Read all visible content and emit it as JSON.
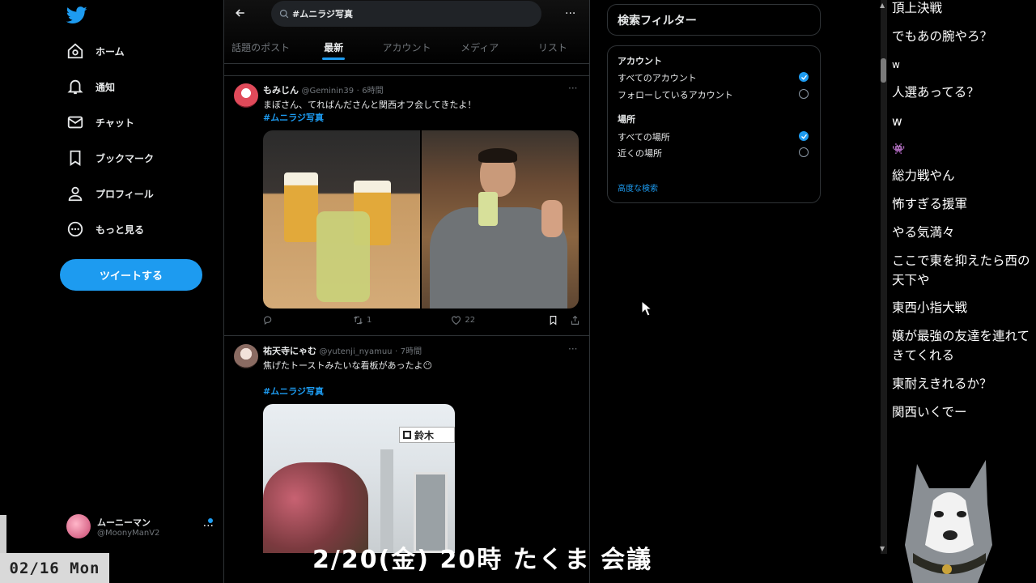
{
  "sidebar": {
    "nav": [
      {
        "label": "ホーム",
        "icon": "home-icon"
      },
      {
        "label": "通知",
        "icon": "bell-icon"
      },
      {
        "label": "チャット",
        "icon": "mail-icon"
      },
      {
        "label": "ブックマーク",
        "icon": "bookmark-icon"
      },
      {
        "label": "プロフィール",
        "icon": "person-icon"
      },
      {
        "label": "もっと見る",
        "icon": "more-circle-icon"
      }
    ],
    "tweet_button": "ツイートする",
    "account": {
      "name": "ムーニーマン",
      "handle": "@MoonyManV2",
      "more": "···"
    }
  },
  "search": {
    "query": "#ムニラジ写真",
    "more": "···"
  },
  "tabs": [
    {
      "label": "話題のポスト",
      "active": false
    },
    {
      "label": "最新",
      "active": true
    },
    {
      "label": "アカウント",
      "active": false
    },
    {
      "label": "メディア",
      "active": false
    },
    {
      "label": "リスト",
      "active": false
    }
  ],
  "tweets": [
    {
      "name": "もみじん",
      "handle": "@Geminin39",
      "time": "6時間",
      "text": "まぼさん、てればんださんと関西オフ会してきたよ！",
      "hashtag": "#ムニラジ写真",
      "retweets": "1",
      "likes": "22",
      "more": "···"
    },
    {
      "name": "祐天寺にゃむ",
      "handle": "@yutenji_nyamuu",
      "time": "7時間",
      "text": "焦げたトーストみたいな看板があったよ😶",
      "hashtag": "#ムニラジ写真",
      "sign_text": "鈴木",
      "more": "···"
    }
  ],
  "filters": {
    "title": "検索フィルター",
    "account_section": "アカウント",
    "account_options": [
      {
        "label": "すべてのアカウント",
        "selected": true
      },
      {
        "label": "フォローしているアカウント",
        "selected": false
      }
    ],
    "place_section": "場所",
    "place_options": [
      {
        "label": "すべての場所",
        "selected": true
      },
      {
        "label": "近くの場所",
        "selected": false
      }
    ],
    "advanced": "高度な検索"
  },
  "chat": [
    "頂上決戦",
    "でもあの腕やろ？",
    "w",
    "人選あってる？",
    "w",
    "👾",
    "総力戦やん",
    "怖すぎる援軍",
    "やる気満々",
    "ここで東を抑えたら西の天下や",
    "東西小指大戦",
    "嬢が最強の友達を連れてきてくれる",
    "東耐えきれるか？",
    "関西いくでー"
  ],
  "overlay": {
    "date": "02/16 Mon",
    "subtitle": "2/20(金) 20時 たくま 会議"
  },
  "colors": {
    "accent": "#1d9bf0",
    "background": "#000000",
    "border": "#2f3336",
    "muted": "#71767b"
  }
}
